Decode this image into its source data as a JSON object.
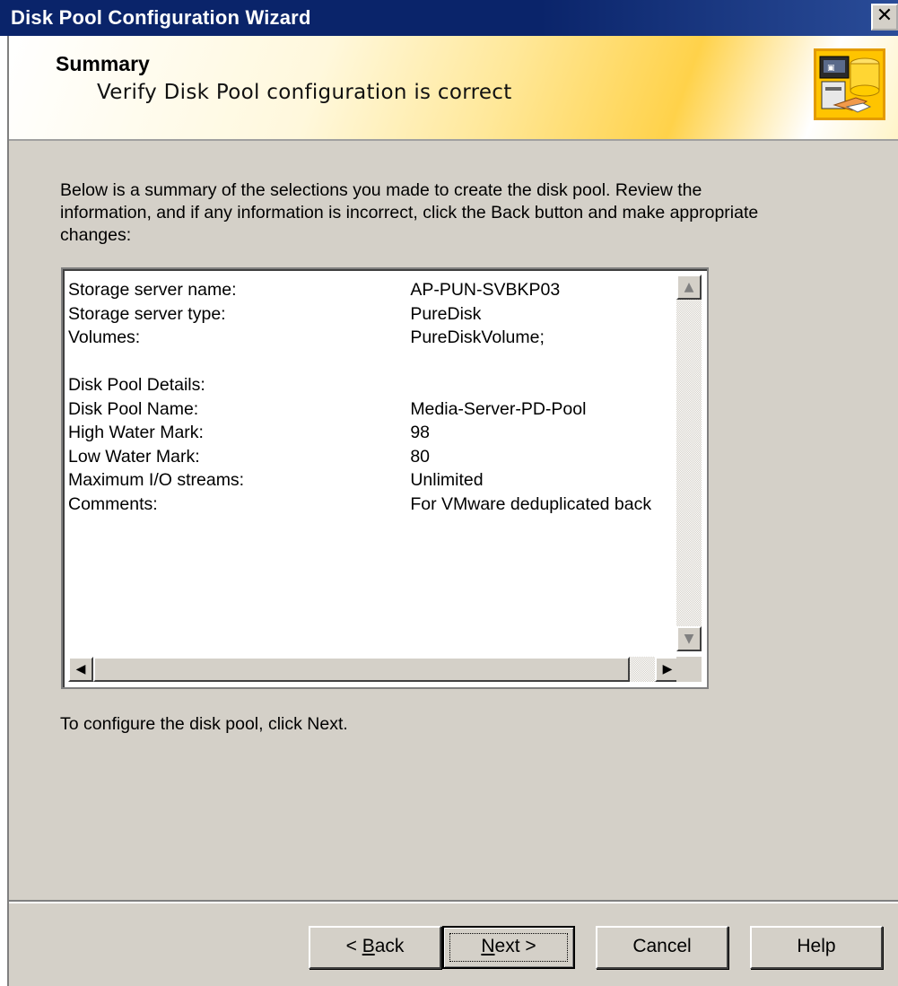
{
  "window": {
    "title": "Disk Pool Configuration Wizard",
    "close_glyph": "✕"
  },
  "header": {
    "title": "Summary",
    "subtitle": "Verify Disk Pool configuration is correct"
  },
  "intro_text": "Below is a summary of the selections you made to create the disk pool. Review the information, and if any information is incorrect, click the Back button and make appropriate changes:",
  "summary": {
    "rows": [
      {
        "label": "Storage server name:",
        "value": "AP-PUN-SVBKP03"
      },
      {
        "label": "Storage server type:",
        "value": "PureDisk"
      },
      {
        "label": "Volumes:",
        "value": "PureDiskVolume;"
      },
      {
        "label": "",
        "value": ""
      },
      {
        "label": "Disk Pool Details:",
        "value": ""
      },
      {
        "label": "Disk Pool Name:",
        "value": "Media-Server-PD-Pool"
      },
      {
        "label": "High Water Mark:",
        "value": "98"
      },
      {
        "label": "Low Water Mark:",
        "value": "80"
      },
      {
        "label": "Maximum I/O streams:",
        "value": "Unlimited"
      },
      {
        "label": "Comments:",
        "value": "For VMware deduplicated back"
      }
    ]
  },
  "scroll_glyphs": {
    "up": "▲",
    "down": "▼",
    "left": "◀",
    "right": "▶"
  },
  "outro_text": "To configure the disk pool, click Next.",
  "buttons": {
    "back": {
      "prefix": "< ",
      "mnemonic": "B",
      "rest": "ack"
    },
    "next": {
      "mnemonic": "N",
      "rest": "ext >"
    },
    "cancel": "Cancel",
    "help": "Help"
  },
  "colors": {
    "titlebar": "#0a246a",
    "dialog_bg": "#d4d0c8",
    "header_accent": "#ffc400"
  },
  "icons": {
    "header": "disk-pool-wizard-icon"
  }
}
